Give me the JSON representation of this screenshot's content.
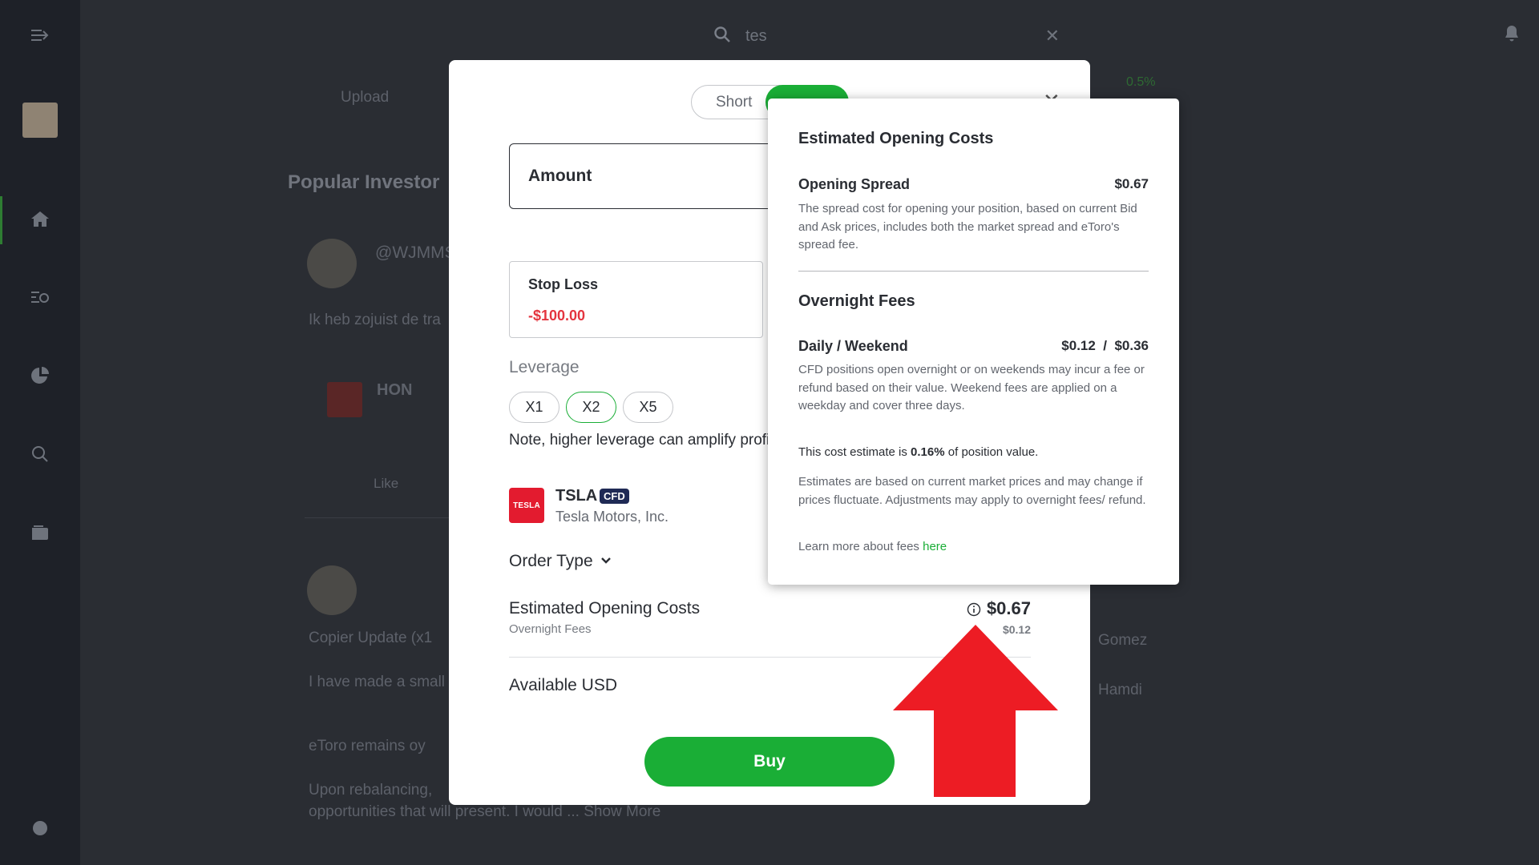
{
  "search": {
    "value": "tes"
  },
  "feed": {
    "upload_label": "Upload",
    "section_title": "Popular Investor",
    "post1_user": "@WJMMS",
    "post1_text": "Ik heb zojuist de tra",
    "instrument_ticker": "HON",
    "like_label": "Like",
    "post2_text_1": "Copier Update (x1",
    "post2_text_2": "I have made a small",
    "post2_text_3": "eToro remains oy",
    "post2_text_4": "Upon rebalancing,",
    "post2_text_5": "opportunities that will present. I would ... Show More"
  },
  "right_panel": {
    "pct": "0.5%",
    "name1": "Gomez",
    "name2": "Hamdi"
  },
  "modal": {
    "toggle_short": "Short",
    "amount_label": "Amount",
    "stop_loss_label": "Stop Loss",
    "stop_loss_value": "-$100.00",
    "leverage_label": "Leverage",
    "leverage_options": [
      "X1",
      "X2",
      "X5"
    ],
    "leverage_selected": "X2",
    "leverage_note": "Note, higher leverage can amplify profit a",
    "instrument": {
      "logo_text": "TESLA",
      "ticker": "TSLA",
      "badge": "CFD",
      "name": "Tesla Motors, Inc."
    },
    "order_type_label": "Order Type",
    "est_costs_label": "Estimated Opening Costs",
    "overnight_label": "Overnight Fees",
    "est_costs_value": "$0.67",
    "overnight_value": "$0.12",
    "available_label": "Available USD",
    "buy_label": "Buy"
  },
  "popup": {
    "title": "Estimated Opening Costs",
    "spread_label": "Opening Spread",
    "spread_value": "$0.67",
    "spread_desc": "The spread cost for opening your position, based on current Bid and Ask prices, includes both the market spread and eToro's spread fee.",
    "overnight_title": "Overnight Fees",
    "daily_label": "Daily / Weekend",
    "daily_value": "$0.12  /  $0.36",
    "overnight_desc": "CFD positions open overnight or on weekends may incur a fee or refund based on their value. Weekend fees are applied on a weekday and cover three days.",
    "cost_prefix": "This cost estimate is ",
    "cost_pct": "0.16%",
    "cost_suffix": " of position value.",
    "estimate_desc": "Estimates are based on current market prices and may change if prices fluctuate. Adjustments may apply to overnight fees/ refund.",
    "learn_prefix": "Learn more about fees ",
    "learn_link": "here"
  },
  "colors": {
    "accent_green": "#1aae36",
    "loss_red": "#e4353f",
    "arrow_red": "#ed1c24",
    "cfd_badge": "#1f2a55"
  }
}
